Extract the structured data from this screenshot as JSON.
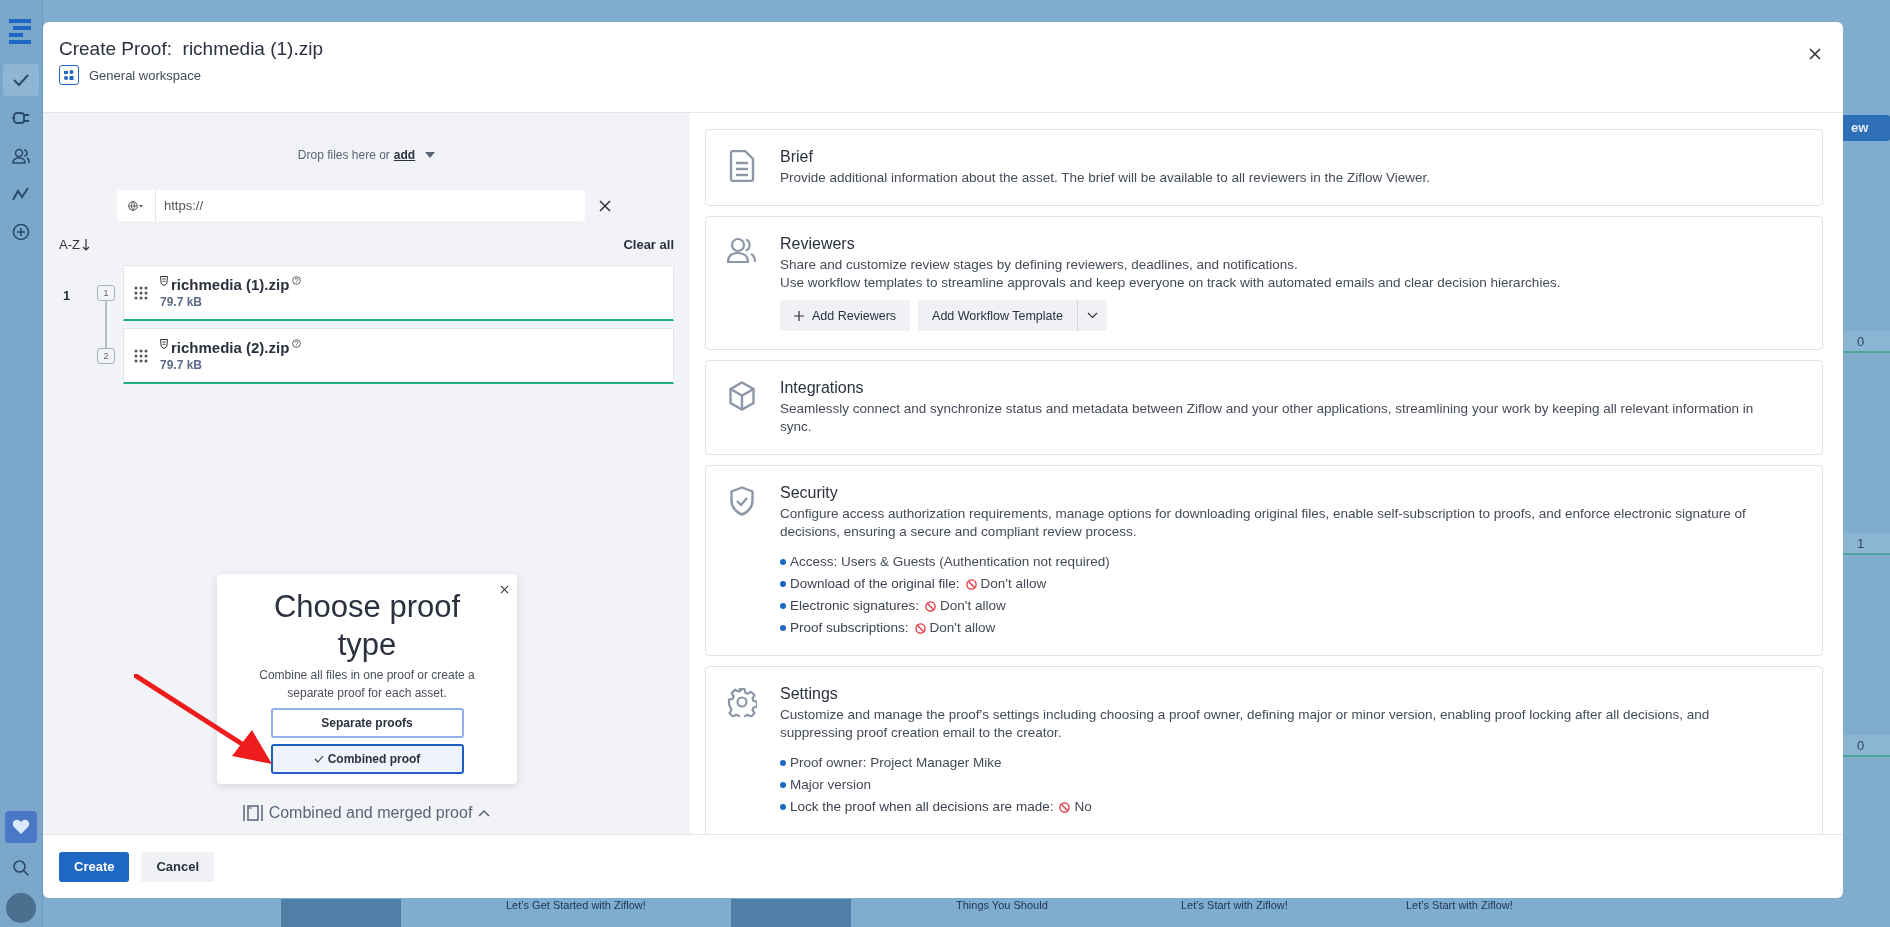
{
  "background": {
    "sidebar": [
      {
        "kind": "logo",
        "selected": false
      },
      {
        "kind": "check",
        "selected": true
      },
      {
        "kind": "plug",
        "selected": false
      },
      {
        "kind": "users",
        "selected": false
      },
      {
        "kind": "chart",
        "selected": false
      },
      {
        "kind": "add",
        "selected": false
      }
    ],
    "sidebar_bottom": [
      {
        "kind": "heart"
      },
      {
        "kind": "search"
      },
      {
        "kind": "avatar"
      }
    ],
    "thumbnails": [
      {
        "kind": "photo"
      },
      {
        "kind": "text",
        "caption": "Let’s Get Started with Ziflow!"
      },
      {
        "kind": "photo"
      },
      {
        "kind": "text",
        "caption": "Things You Should"
      },
      {
        "kind": "text",
        "caption": "Let’s Start with Ziflow!"
      },
      {
        "kind": "text",
        "caption": "Let’s Start with Ziflow!"
      }
    ],
    "right_strip": {
      "button": "ew",
      "counts": [
        "0",
        "1",
        "0"
      ]
    }
  },
  "dialog": {
    "title": "Create Proof:  richmedia (1).zip",
    "workspace": "General workspace"
  },
  "upload": {
    "drop_text": "Drop files here or",
    "add_link": "add",
    "url_value": "https://",
    "sort_label": "A-Z",
    "clear_all": "Clear all"
  },
  "groups": [
    {
      "number": "1",
      "files": [
        {
          "step": "1",
          "name": "richmedia (1).zip",
          "size": "79.7 kB"
        },
        {
          "step": "2",
          "name": "richmedia (2).zip",
          "size": "79.7 kB"
        }
      ]
    }
  ],
  "proof_type_popup": {
    "title": "Choose proof type",
    "text": "Combine all files in one proof or create a separate proof for each asset.",
    "options": [
      {
        "label": "Separate proofs",
        "selected": false
      },
      {
        "label": "Combined proof",
        "selected": true
      }
    ]
  },
  "proof_type_toggle": "Combined and merged proof",
  "sections": [
    {
      "kind": "brief",
      "title": "Brief",
      "lines": [
        "Provide additional information about the asset. The brief will be available to all reviewers in the Ziflow Viewer."
      ]
    },
    {
      "kind": "reviewers",
      "title": "Reviewers",
      "lines": [
        "Share and customize review stages by defining reviewers, deadlines, and notifications.",
        "Use workflow templates to streamline approvals and keep everyone on track with automated emails and clear decision hierarchies."
      ],
      "buttons": [
        {
          "kind": "add",
          "label": "Add Reviewers"
        },
        {
          "kind": "split",
          "label": "Add Workflow Template"
        }
      ]
    },
    {
      "kind": "integrations",
      "title": "Integrations",
      "lines": [
        "Seamlessly connect and synchronize status and metadata between Ziflow and your other applications, streamlining your work by keeping all relevant information in sync."
      ]
    },
    {
      "kind": "security",
      "title": "Security",
      "lines": [
        "Configure access authorization requirements, manage options for downloading original files, enable self-subscription to proofs, and enforce electronic signature of decisions, ensuring a secure and compliant review process."
      ],
      "bullets": [
        {
          "label": "Access: Users & Guests (Authentication not required)",
          "denied": false
        },
        {
          "label": "Download of the original file:",
          "denied": true,
          "value": "Don't allow"
        },
        {
          "label": "Electronic signatures:",
          "denied": true,
          "value": "Don't allow"
        },
        {
          "label": "Proof subscriptions:",
          "denied": true,
          "value": "Don't allow"
        }
      ]
    },
    {
      "kind": "settings",
      "title": "Settings",
      "lines": [
        "Customize and manage the proof's settings including choosing a proof owner, defining major or minor version, enabling proof locking after all decisions, and suppressing proof creation email to the creator."
      ],
      "bullets": [
        {
          "label": "Proof owner: Project Manager Mike",
          "denied": false
        },
        {
          "label": "Major version",
          "denied": false
        },
        {
          "label": "Lock the proof when all decisions are made:",
          "denied": true,
          "value": "No"
        }
      ]
    }
  ],
  "footer": {
    "buttons": [
      {
        "label": "Create",
        "primary": true
      },
      {
        "label": "Cancel",
        "primary": false
      }
    ]
  }
}
